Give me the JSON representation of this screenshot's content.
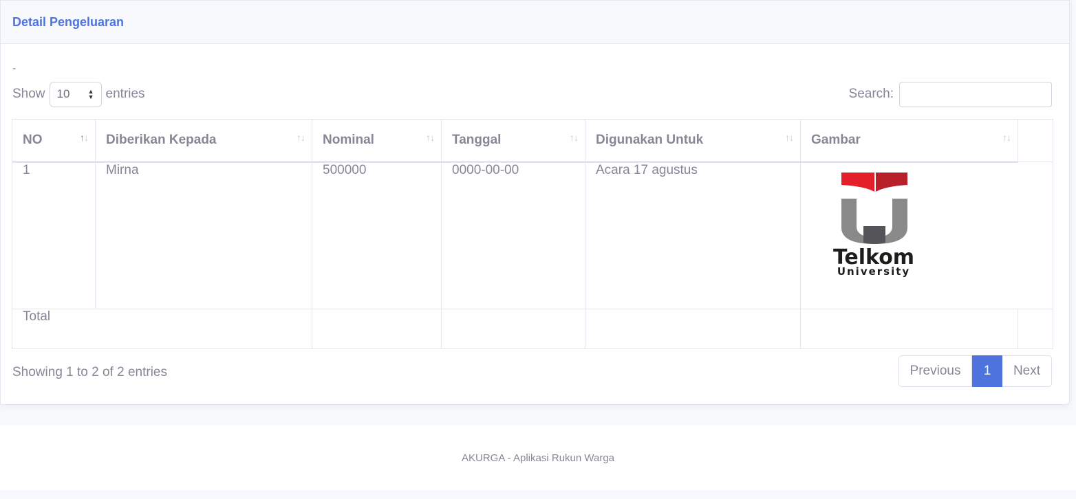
{
  "card": {
    "title": "Detail Pengeluaran",
    "dash": "-"
  },
  "length": {
    "show_label": "Show",
    "value": "10",
    "entries_label": "entries"
  },
  "search": {
    "label": "Search:",
    "value": ""
  },
  "table": {
    "headers": [
      "NO",
      "Diberikan Kepada",
      "Nominal",
      "Tanggal",
      "Digunakan Untuk",
      "Gambar"
    ],
    "rows": [
      {
        "no": "1",
        "diberikan_kepada": "Mirna",
        "nominal": "500000",
        "tanggal": "0000-00-00",
        "digunakan_untuk": "Acara 17 agustus",
        "gambar_logo_text": "Telkom",
        "gambar_logo_subtext": "University"
      }
    ],
    "total_label": "Total"
  },
  "info": "Showing 1 to 2 of 2 entries",
  "pagination": {
    "previous": "Previous",
    "current": "1",
    "next": "Next"
  },
  "footer": "AKURGA - Aplikasi Rukun Warga",
  "colors": {
    "primary": "#4e73df",
    "text": "#858796",
    "logo_red": "#e31f2a",
    "logo_gray": "#898989"
  }
}
